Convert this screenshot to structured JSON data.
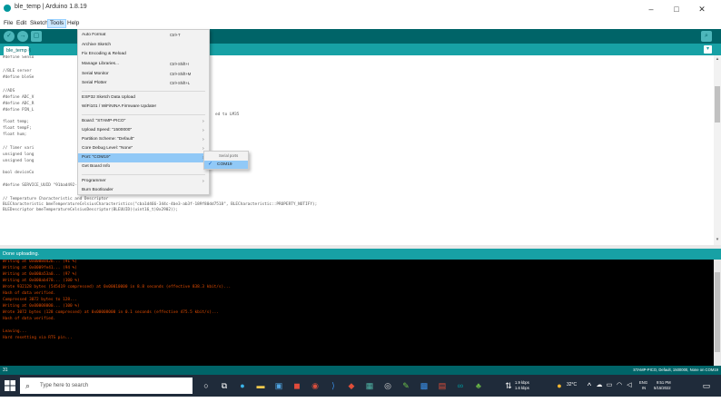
{
  "window": {
    "title": "ble_temp | Arduino 1.8.19",
    "minimize": "–",
    "maximize": "□",
    "close": "✕"
  },
  "menubar": {
    "items": [
      "File",
      "Edit",
      "Sketch",
      "Tools",
      "Help"
    ],
    "active": "Tools"
  },
  "toolbar": {
    "verify": "✓",
    "upload": "→",
    "new": "▢",
    "serial_monitor": "⌕"
  },
  "tab": {
    "label": "ble_temp §",
    "menu": "▾"
  },
  "editor": {
    "lines": [
      "#define Senso",
      "",
      "//BLE server",
      "#define bleSe",
      "",
      "//ADS",
      "#define ADC_V",
      "#define ADC_R",
      "#define PIN_L",
      "",
      "float temp;",
      "float tempF;",
      "float hum;",
      "",
      "// Timer vari",
      "unsigned long",
      "unsigned long",
      "",
      "bool deviceCo",
      "",
      "#define SERVICE_UUID \"91bad492-b950-4226-aa2b-4ede9fa42f59\"",
      "",
      "// Temperature Characteristic and Descriptor",
      "BLECharacteristic bmeTemperatureCelsiusCharacteristics(\"cba1d466-344c-4be3-ab3f-189f80dd7518\", BLECharacteristic::PROPERTY_NOTIFY);",
      "BLEDescriptor bmeTemperatureCelsiusDescriptor(BLEUUID((uint16_t)0x2902));"
    ],
    "inline_comment": "ed to LM35"
  },
  "status": {
    "message": "Done uploading."
  },
  "console": {
    "lines": [
      "Writing at 0x0008d42b... (91 %)",
      "Writing at 0x0009fe41... (94 %)",
      "Writing at 0x000a53a0... (97 %)",
      "Writing at 0x000ab470... (100 %)",
      "Wrote 932128 bytes (545419 compressed) at 0x00010000 in 8.8 seconds (effective 838.3 kbit/s)...",
      "Hash of data verified.",
      "Compressed 3072 bytes to 128...",
      "Writing at 0x00008000... (100 %)",
      "Wrote 3072 bytes (128 compressed) at 0x00008000 in 0.1 seconds (effective 475.5 kbit/s)...",
      "Hash of data verified.",
      "",
      "Leaving...",
      "Hard resetting via RTS pin..."
    ]
  },
  "bottom": {
    "line_number": "31",
    "board_info": "STAMP-PICO, Default, 1500000, None on COM19"
  },
  "tools_menu": {
    "items": [
      {
        "label": "Auto Format",
        "shortcut": "Ctrl+T",
        "submenu": false
      },
      {
        "label": "Archive Sketch",
        "shortcut": "",
        "submenu": false
      },
      {
        "label": "Fix Encoding & Reload",
        "shortcut": "",
        "submenu": false
      },
      {
        "label": "Manage Libraries...",
        "shortcut": "Ctrl+Shift+I",
        "submenu": false
      },
      {
        "label": "Serial Monitor",
        "shortcut": "Ctrl+Shift+M",
        "submenu": false
      },
      {
        "label": "Serial Plotter",
        "shortcut": "Ctrl+Shift+L",
        "submenu": false
      },
      {
        "label": "ESP32 Sketch Data Upload",
        "shortcut": "",
        "submenu": false
      },
      {
        "label": "WiFi101 / WiFiNINA Firmware Updater",
        "shortcut": "",
        "submenu": false
      },
      {
        "label": "Board: \"STAMP-PICO\"",
        "shortcut": "",
        "submenu": true
      },
      {
        "label": "Upload Speed: \"1500000\"",
        "shortcut": "",
        "submenu": true
      },
      {
        "label": "Partition Scheme: \"Default\"",
        "shortcut": "",
        "submenu": true
      },
      {
        "label": "Core Debug Level: \"None\"",
        "shortcut": "",
        "submenu": true
      },
      {
        "label": "Port: \"COM19\"",
        "shortcut": "",
        "submenu": true
      },
      {
        "label": "Get Board Info",
        "shortcut": "",
        "submenu": false
      },
      {
        "label": "Programmer",
        "shortcut": "",
        "submenu": true
      },
      {
        "label": "Burn Bootloader",
        "shortcut": "",
        "submenu": false
      }
    ],
    "highlighted": "Port: \"COM19\""
  },
  "port_submenu": {
    "header": "Serial ports",
    "item": "COM19",
    "checked": true
  },
  "taskbar": {
    "search_placeholder": "Type here to search",
    "network_up": "1.9 kbps",
    "network_down": "1.6 kbps",
    "weather": "32°C",
    "lang_top": "ENG",
    "lang_bottom": "IN",
    "time": "9:51 PM",
    "date": "5/15/2022"
  },
  "colors": {
    "arduino_dark": "#006468",
    "arduino_teal": "#17a1a5",
    "console_text": "#e34c00",
    "taskbar": "#1f2b3a",
    "menu_highlight": "#91c9f7"
  }
}
